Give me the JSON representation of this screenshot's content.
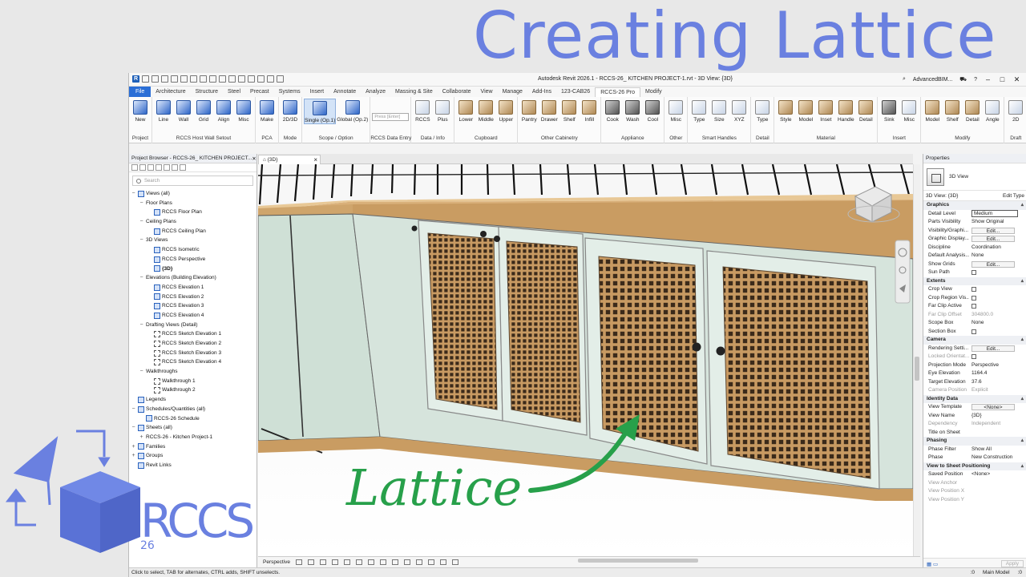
{
  "headline": "Creating Lattice",
  "window": {
    "title": "Autodesk Revit 2026.1 - RCCS-26_ KITCHEN PROJECT-1.rvt - 3D View: {3D}",
    "user": "AdvancedBIM...",
    "controls": [
      "–",
      "□",
      "✕"
    ]
  },
  "tabs": [
    "File",
    "Architecture",
    "Structure",
    "Steel",
    "Precast",
    "Systems",
    "Insert",
    "Annotate",
    "Analyze",
    "Massing & Site",
    "Collaborate",
    "View",
    "Manage",
    "Add-Ins",
    "123-CAB26",
    "RCCS-26 Pro",
    "Modify"
  ],
  "ribbon": {
    "groups": [
      {
        "label": "Project",
        "tools": [
          "New"
        ]
      },
      {
        "label": "RCCS Host Wall Setout",
        "tools": [
          "Line",
          "Wall",
          "Grid",
          "Align",
          "Misc"
        ]
      },
      {
        "label": "PCA",
        "tools": [
          "Make"
        ]
      },
      {
        "label": "Mode",
        "tools": [
          "2D/3D"
        ]
      },
      {
        "label": "Scope / Option",
        "tools": [
          "Single (Op.1)",
          "Global (Op.2)"
        ]
      },
      {
        "label": "RCCS Data Entry",
        "tools": [],
        "input_placeholder": "Press [Enter]"
      },
      {
        "label": "Data / Info",
        "tools": [
          "RCCS",
          "Plus"
        ]
      },
      {
        "label": "Cupboard",
        "tools": [
          "Lower",
          "Middle",
          "Upper"
        ]
      },
      {
        "label": "Other Cabinetry",
        "tools": [
          "Pantry",
          "Drawer",
          "Shelf",
          "Infill"
        ]
      },
      {
        "label": "Appliance",
        "tools": [
          "Cook",
          "Wash",
          "Cool"
        ]
      },
      {
        "label": "Other",
        "tools": [
          "Misc"
        ]
      },
      {
        "label": "Smart Handles",
        "tools": [
          "Type",
          "Size",
          "XYZ"
        ]
      },
      {
        "label": "Detail",
        "tools": [
          "Type"
        ]
      },
      {
        "label": "Material",
        "tools": [
          "Style",
          "Model",
          "Inset",
          "Handle",
          "Detail"
        ]
      },
      {
        "label": "Insert",
        "tools": [
          "Sink",
          "Misc"
        ]
      },
      {
        "label": "Modify",
        "tools": [
          "Model",
          "Shelf",
          "Detail",
          "Angle"
        ]
      },
      {
        "label": "Draft",
        "tools": [
          "2D"
        ]
      }
    ]
  },
  "project_browser": {
    "title": "Project Browser - RCCS-26_ KITCHEN PROJECT...",
    "search_placeholder": "Search",
    "items": [
      {
        "label": "Views (all)",
        "level": 0,
        "toggle": "−",
        "icon": "views"
      },
      {
        "label": "Floor Plans",
        "level": 1,
        "toggle": "−"
      },
      {
        "label": "RCCS Floor Plan",
        "level": 2,
        "icon": "view"
      },
      {
        "label": "Ceiling Plans",
        "level": 1,
        "toggle": "−"
      },
      {
        "label": "RCCS Ceiling Plan",
        "level": 2,
        "icon": "view"
      },
      {
        "label": "3D Views",
        "level": 1,
        "toggle": "−"
      },
      {
        "label": "RCCS Isometric",
        "level": 2,
        "icon": "view"
      },
      {
        "label": "RCCS Perspective",
        "level": 2,
        "icon": "view"
      },
      {
        "label": "{3D}",
        "level": 2,
        "icon": "view",
        "bold": true
      },
      {
        "label": "Elevations (Building Elevation)",
        "level": 1,
        "toggle": "−"
      },
      {
        "label": "RCCS Elevation 1",
        "level": 2,
        "icon": "view"
      },
      {
        "label": "RCCS Elevation 2",
        "level": 2,
        "icon": "view"
      },
      {
        "label": "RCCS Elevation 3",
        "level": 2,
        "icon": "view"
      },
      {
        "label": "RCCS Elevation 4",
        "level": 2,
        "icon": "view"
      },
      {
        "label": "Drafting Views (Detail)",
        "level": 1,
        "toggle": "−"
      },
      {
        "label": "RCCS Sketch Elevation 1",
        "level": 2,
        "icon": "draft"
      },
      {
        "label": "RCCS Sketch Elevation 2",
        "level": 2,
        "icon": "draft"
      },
      {
        "label": "RCCS Sketch Elevation 3",
        "level": 2,
        "icon": "draft"
      },
      {
        "label": "RCCS Sketch Elevation 4",
        "level": 2,
        "icon": "draft"
      },
      {
        "label": "Walkthroughs",
        "level": 1,
        "toggle": "−"
      },
      {
        "label": "Walkthrough 1",
        "level": 2,
        "icon": "draft"
      },
      {
        "label": "Walkthrough 2",
        "level": 2,
        "icon": "draft"
      },
      {
        "label": "Legends",
        "level": 0,
        "icon": "view"
      },
      {
        "label": "Schedules/Quantities (all)",
        "level": 0,
        "toggle": "−",
        "icon": "view"
      },
      {
        "label": "RCCS-26 Schedule",
        "level": 1,
        "icon": "view"
      },
      {
        "label": "Sheets (all)",
        "level": 0,
        "toggle": "−",
        "icon": "view"
      },
      {
        "label": "RCCS-26 - Kitchen Project-1",
        "level": 1,
        "toggle": "+"
      },
      {
        "label": "Families",
        "level": 0,
        "toggle": "+",
        "icon": "view"
      },
      {
        "label": "Groups",
        "level": 0,
        "toggle": "+",
        "icon": "view"
      },
      {
        "label": "Revit Links",
        "level": 0,
        "icon": "link"
      }
    ]
  },
  "view_tab": {
    "label": "{3D}"
  },
  "scene": {
    "annotation": "Lattice"
  },
  "view_control": {
    "scale": "Perspective"
  },
  "properties": {
    "title": "Properties",
    "type_name": "3D View",
    "instance": "3D View: {3D}",
    "edit_type": "Edit Type",
    "sections": [
      {
        "name": "Graphics",
        "rows": [
          {
            "k": "Detail Level",
            "v": "Medium",
            "style": "boxed"
          },
          {
            "k": "Parts Visibility",
            "v": "Show Original"
          },
          {
            "k": "Visibility/Graphi...",
            "v": "Edit...",
            "style": "button"
          },
          {
            "k": "Graphic Display...",
            "v": "Edit...",
            "style": "button"
          },
          {
            "k": "Discipline",
            "v": "Coordination"
          },
          {
            "k": "Default Analysis...",
            "v": "None"
          },
          {
            "k": "Show Grids",
            "v": "Edit...",
            "style": "button"
          },
          {
            "k": "Sun Path",
            "v": "",
            "style": "check"
          }
        ]
      },
      {
        "name": "Extents",
        "rows": [
          {
            "k": "Crop View",
            "v": "",
            "style": "check"
          },
          {
            "k": "Crop Region Vis...",
            "v": "",
            "style": "check"
          },
          {
            "k": "Far Clip Active",
            "v": "",
            "style": "check"
          },
          {
            "k": "Far Clip Offset",
            "v": "304800.0",
            "style": "dim"
          },
          {
            "k": "Scope Box",
            "v": "None"
          },
          {
            "k": "Section Box",
            "v": "",
            "style": "check"
          }
        ]
      },
      {
        "name": "Camera",
        "rows": [
          {
            "k": "Rendering Setti...",
            "v": "Edit...",
            "style": "button"
          },
          {
            "k": "Locked Orientat...",
            "v": "",
            "style": "dimcheck"
          },
          {
            "k": "Projection Mode",
            "v": "Perspective"
          },
          {
            "k": "Eye Elevation",
            "v": "1164.4"
          },
          {
            "k": "Target Elevation",
            "v": "37.6"
          },
          {
            "k": "Camera Position",
            "v": "Explicit",
            "style": "dim"
          }
        ]
      },
      {
        "name": "Identity Data",
        "rows": [
          {
            "k": "View Template",
            "v": "<None>",
            "style": "button"
          },
          {
            "k": "View Name",
            "v": "{3D}"
          },
          {
            "k": "Dependency",
            "v": "Independent",
            "style": "dim"
          },
          {
            "k": "Title on Sheet",
            "v": ""
          }
        ]
      },
      {
        "name": "Phasing",
        "rows": [
          {
            "k": "Phase Filter",
            "v": "Show All"
          },
          {
            "k": "Phase",
            "v": "New Construction"
          }
        ]
      },
      {
        "name": "View to Sheet Positioning",
        "rows": [
          {
            "k": "Saved Position",
            "v": "<None>"
          },
          {
            "k": "View Anchor",
            "v": "",
            "style": "dim"
          },
          {
            "k": "View Position X",
            "v": "",
            "style": "dim"
          },
          {
            "k": "View Position Y",
            "v": "",
            "style": "dim"
          }
        ]
      }
    ],
    "apply": "Apply"
  },
  "status": {
    "hint": "Click to select, TAB for alternates, CTRL adds, SHIFT unselects.",
    "right": [
      ":0",
      "Main Model",
      ":0"
    ]
  },
  "logo": {
    "letters": "RCCS",
    "number": "26"
  },
  "colors": {
    "accent": "#6a80e0",
    "file_tab": "#2a6ed6",
    "cabinet": "#d6e4dc",
    "wood": "#caa06b",
    "arrow": "#27a04a"
  }
}
